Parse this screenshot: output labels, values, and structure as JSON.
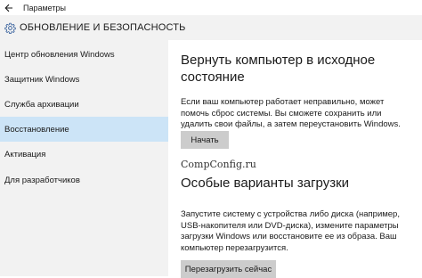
{
  "window": {
    "title": "Параметры",
    "back_icon": "back-arrow-icon"
  },
  "header": {
    "icon": "gear-icon",
    "title": "ОБНОВЛЕНИЕ И БЕЗОПАСНОСТЬ"
  },
  "sidebar": {
    "items": [
      {
        "label": "Центр обновления Windows",
        "selected": false
      },
      {
        "label": "Защитник Windows",
        "selected": false
      },
      {
        "label": "Служба архивации",
        "selected": false
      },
      {
        "label": "Восстановление",
        "selected": true
      },
      {
        "label": "Активация",
        "selected": false
      },
      {
        "label": "Для разработчиков",
        "selected": false
      }
    ]
  },
  "main": {
    "reset": {
      "heading": "Вернуть компьютер в исходное состояние",
      "description": "Если ваш компьютер работает неправильно, может помочь сброс системы. Вы сможете сохранить или удалить свои файлы, а затем переустановить Windows.",
      "button_label": "Начать"
    },
    "watermark": "CompConfig.ru",
    "advanced": {
      "heading": "Особые варианты загрузки",
      "description": "Запустите систему с устройства либо диска (например, USB-накопителя или DVD-диска), измените параметры загрузки Windows или восстановите ее из образа. Ваш компьютер перезагрузится.",
      "button_label": "Перезагрузить сейчас"
    }
  },
  "colors": {
    "sidebar_bg": "#f2f2f2",
    "selected_bg": "#cce4f7",
    "button_bg": "#cccccc"
  }
}
